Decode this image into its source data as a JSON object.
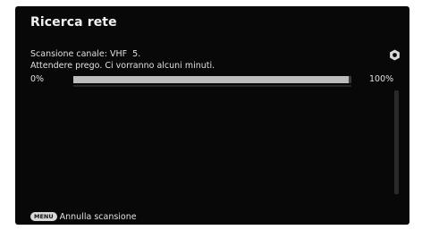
{
  "header": {
    "title": "Ricerca rete"
  },
  "status": {
    "channel_label": "Scansione canale:",
    "channel_value": "VHF  5.",
    "wait_message": "Attendere prego. Ci vorranno alcuni minuti."
  },
  "progress": {
    "start_label": "0%",
    "end_label": "100%",
    "value_percent": 99
  },
  "icons": {
    "scan": "scan-hexagon-icon"
  },
  "footer": {
    "key_label": "MENU",
    "action_label": "Annulla scansione"
  },
  "colors": {
    "background": "#080808",
    "progress_fill": "#bdbdbd",
    "progress_track": "#3a3a3a"
  }
}
